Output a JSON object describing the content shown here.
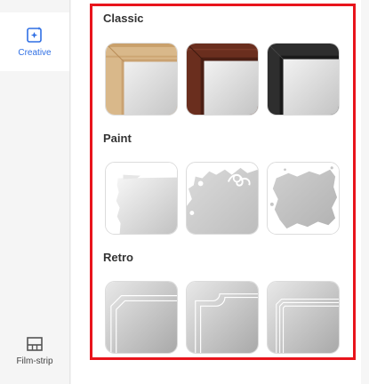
{
  "sidebar": {
    "creative": {
      "label": "Creative",
      "icon": "magic-sparkle-icon"
    },
    "film_strip": {
      "label": "Film-strip",
      "icon": "film-strip-icon"
    }
  },
  "sections": [
    {
      "title": "Classic",
      "items": [
        "wood-light-frame",
        "wood-dark-frame",
        "black-frame"
      ]
    },
    {
      "title": "Paint",
      "items": [
        "paint-edge-frame",
        "floral-paint-frame",
        "splatter-paint-frame"
      ]
    },
    {
      "title": "Retro",
      "items": [
        "retro-double-line-frame",
        "retro-corner-frame",
        "retro-triple-line-frame"
      ]
    }
  ],
  "colors": {
    "accent": "#2f6fe4",
    "highlight": "#e8141c"
  }
}
